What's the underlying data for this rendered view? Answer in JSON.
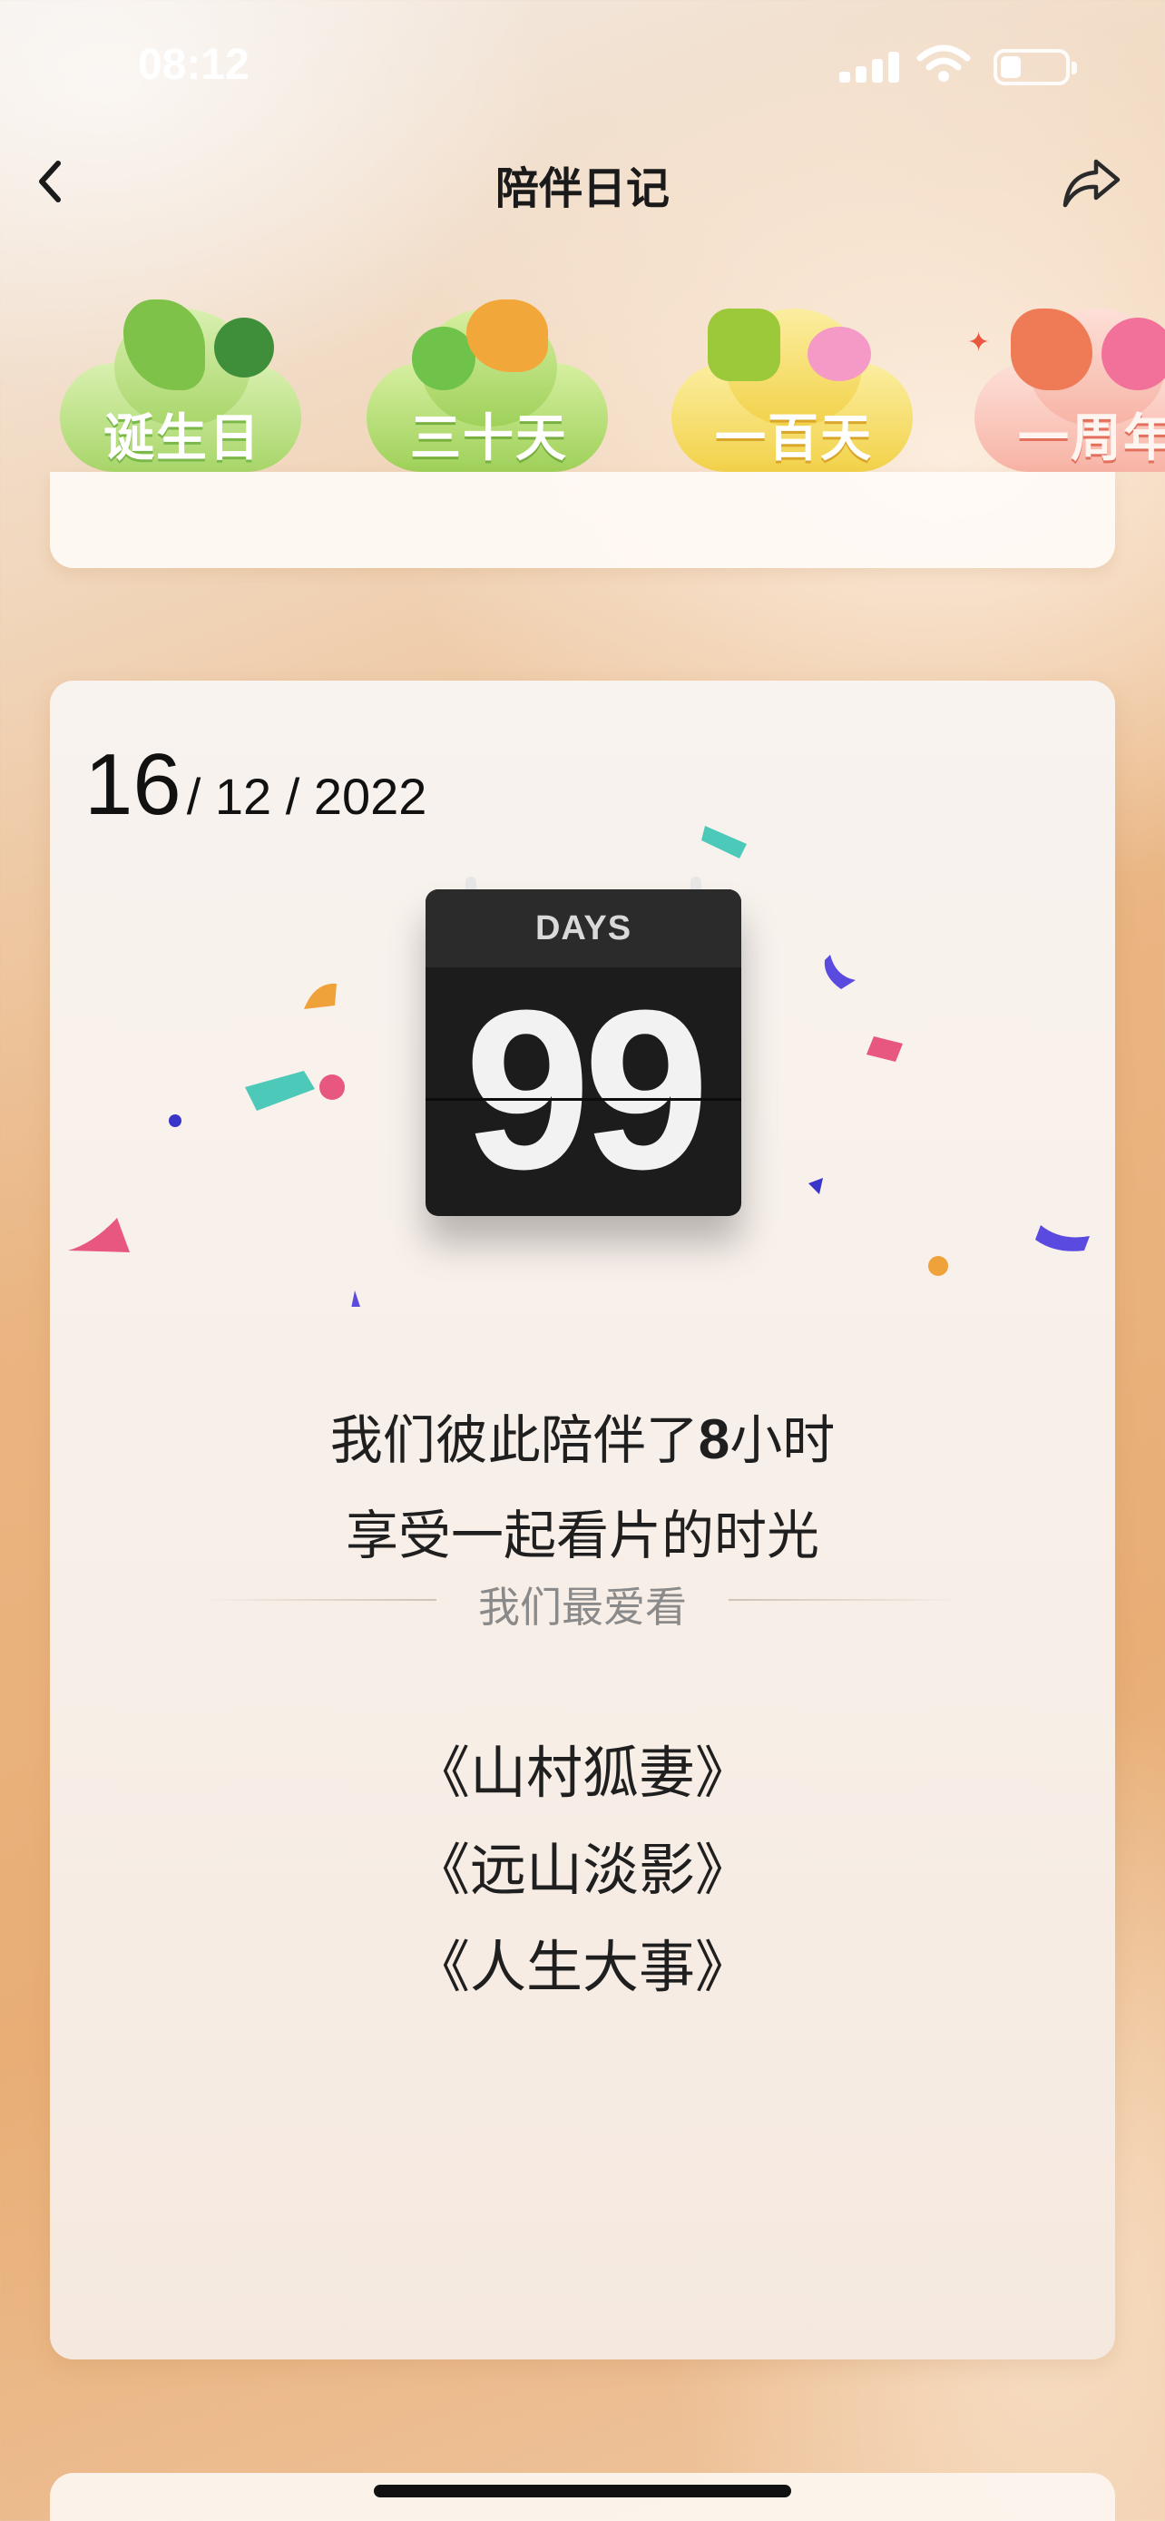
{
  "status_bar": {
    "time": "08:12"
  },
  "nav": {
    "title": "陪伴日记",
    "back_icon": "chevron-left-icon",
    "share_icon": "share-icon"
  },
  "milestones": [
    {
      "label": "诞生日",
      "color": "#a8d66a"
    },
    {
      "label": "三十天",
      "color": "#9fd15a"
    },
    {
      "label": "一百天",
      "color": "#f2d24a"
    },
    {
      "label": "一周年",
      "color": "#f29a8a"
    }
  ],
  "card": {
    "date": {
      "day": "16",
      "rest": "/ 12 / 2022"
    },
    "counter": {
      "header": "DAYS",
      "value": "99"
    },
    "stat_line1_prefix": "我们彼此陪伴了",
    "stat_line1_hours": "8",
    "stat_line1_suffix": "小时",
    "stat_line2": "享受一起看片的时光",
    "favorites_title": "我们最爱看",
    "favorites": [
      "《山村狐妻》",
      "《远山淡影》",
      "《人生大事》"
    ]
  },
  "colors": {
    "accent_orange": "#e8ae76",
    "confetti_pink": "#e8577f",
    "confetti_blue": "#5a4ae0",
    "confetti_teal": "#4cc9b8"
  }
}
